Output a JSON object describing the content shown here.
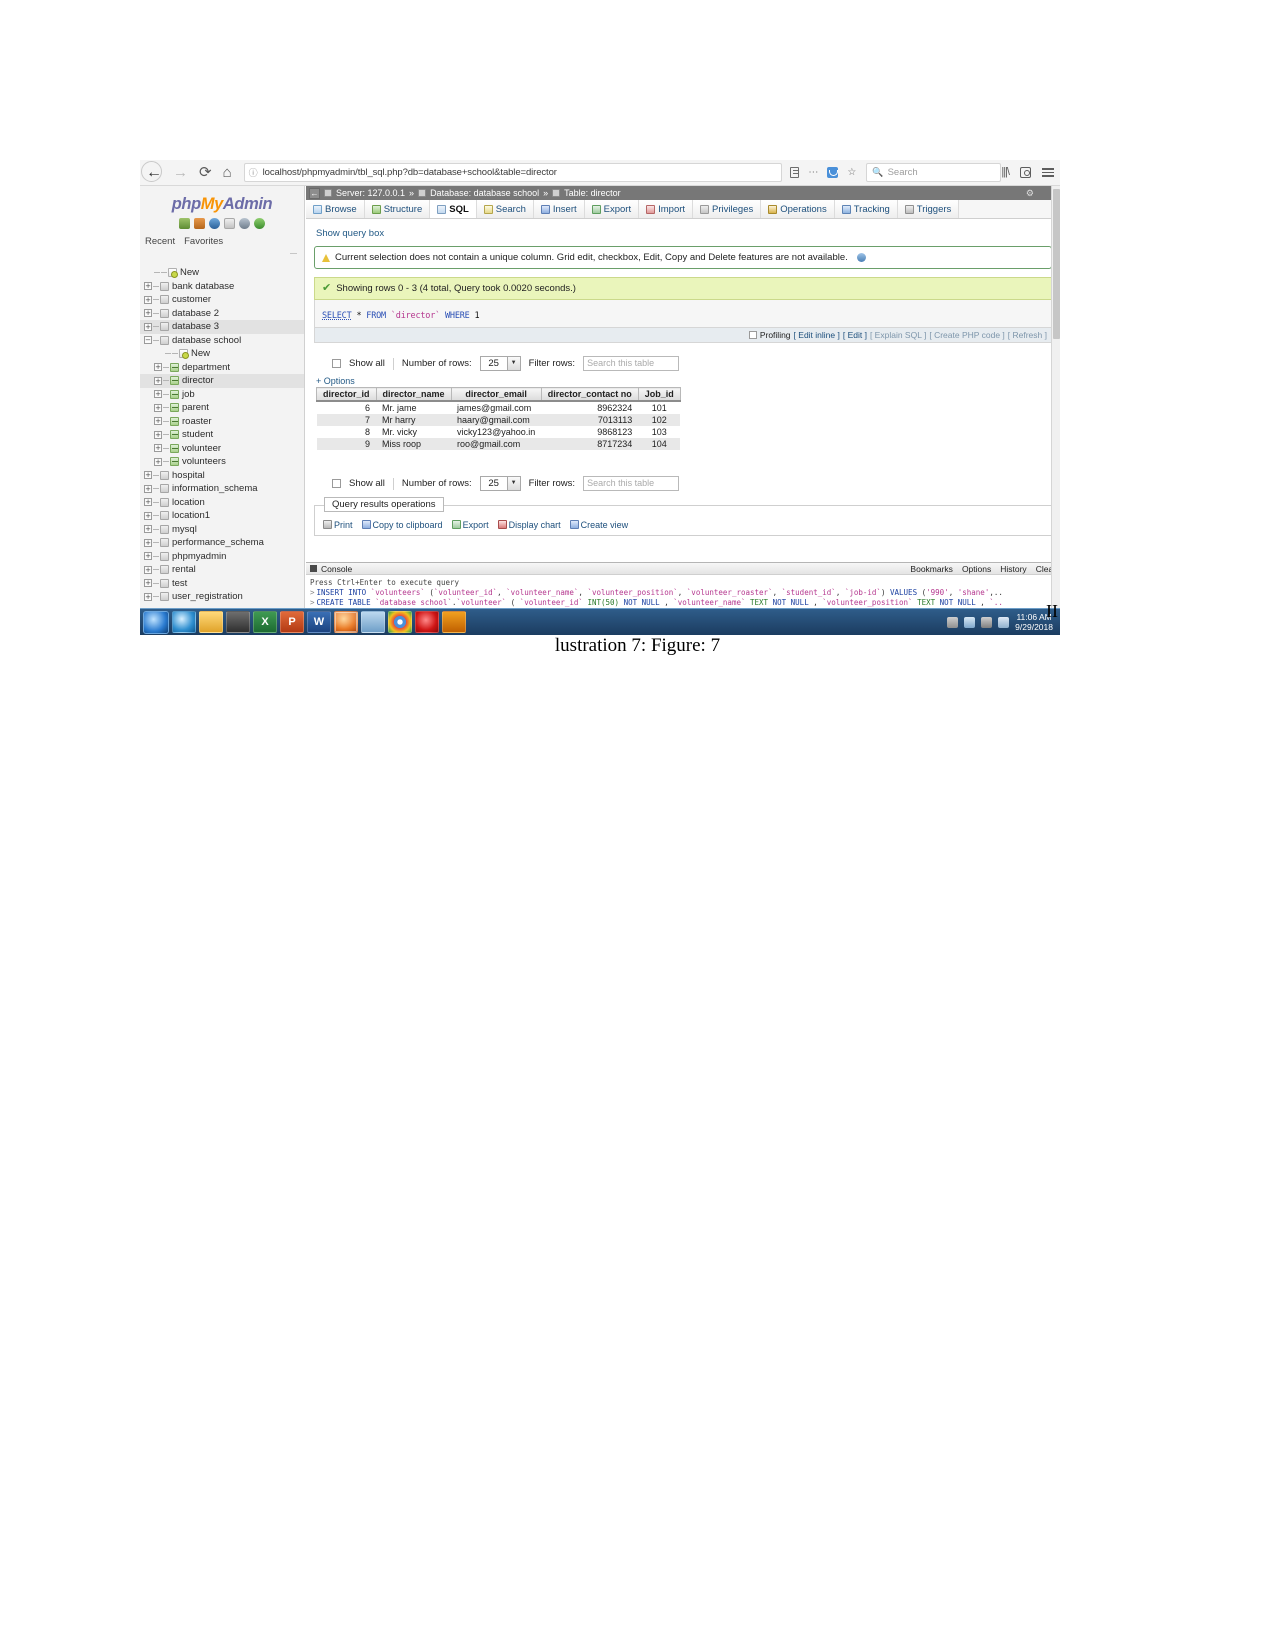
{
  "browser": {
    "nav": {
      "back": "←",
      "forward": "→",
      "reload": "⟳",
      "home": "⌂"
    },
    "url": "localhost/phpmyadmin/tbl_sql.php?db=database+school&table=director",
    "url_info_icon": "ⓘ",
    "search_placeholder": "Search",
    "search_icon": "search-icon",
    "library_icon": "|||\\",
    "reader_icon": "reader-mode-icon",
    "pocket_icon": "pocket-icon",
    "bookmark_icon": "☆",
    "account_icon": "account-icon",
    "menu_icon": "hamburger-icon"
  },
  "sidebar": {
    "logo": {
      "php": "php",
      "my": "My",
      "admin": "Admin"
    },
    "quick_icons": [
      "home-icon",
      "database-icon",
      "sql-icon",
      "docs-icon",
      "settings-icon",
      "reload-icon"
    ],
    "recent": "Recent",
    "favorites": "Favorites",
    "pin_icon": "collapse-icon",
    "tree": [
      {
        "label": "New",
        "level": 1,
        "icon": "new-icon",
        "toggle": "",
        "selected": false
      },
      {
        "label": "bank database",
        "level": 0,
        "icon": "db-icon",
        "toggle": "+",
        "selected": false
      },
      {
        "label": "customer",
        "level": 0,
        "icon": "db-icon",
        "toggle": "+",
        "selected": false
      },
      {
        "label": "database 2",
        "level": 0,
        "icon": "db-icon",
        "toggle": "+",
        "selected": false
      },
      {
        "label": "database 3",
        "level": 0,
        "icon": "db-icon",
        "toggle": "+",
        "selected": true
      },
      {
        "label": "database school",
        "level": 0,
        "icon": "db-icon",
        "toggle": "−",
        "selected": false
      },
      {
        "label": "New",
        "level": 2,
        "icon": "new-icon",
        "toggle": "",
        "selected": false
      },
      {
        "label": "department",
        "level": 1,
        "icon": "table-icon",
        "toggle": "+",
        "selected": false
      },
      {
        "label": "director",
        "level": 1,
        "icon": "table-icon",
        "toggle": "+",
        "selected": true
      },
      {
        "label": "job",
        "level": 1,
        "icon": "table-icon",
        "toggle": "+",
        "selected": false
      },
      {
        "label": "parent",
        "level": 1,
        "icon": "table-icon",
        "toggle": "+",
        "selected": false
      },
      {
        "label": "roaster",
        "level": 1,
        "icon": "table-icon",
        "toggle": "+",
        "selected": false
      },
      {
        "label": "student",
        "level": 1,
        "icon": "table-icon",
        "toggle": "+",
        "selected": false
      },
      {
        "label": "volunteer",
        "level": 1,
        "icon": "table-icon",
        "toggle": "+",
        "selected": false
      },
      {
        "label": "volunteers",
        "level": 1,
        "icon": "table-icon",
        "toggle": "+",
        "selected": false
      },
      {
        "label": "hospital",
        "level": 0,
        "icon": "db-icon",
        "toggle": "+",
        "selected": false
      },
      {
        "label": "information_schema",
        "level": 0,
        "icon": "db-icon",
        "toggle": "+",
        "selected": false
      },
      {
        "label": "location",
        "level": 0,
        "icon": "db-icon",
        "toggle": "+",
        "selected": false
      },
      {
        "label": "location1",
        "level": 0,
        "icon": "db-icon",
        "toggle": "+",
        "selected": false
      },
      {
        "label": "mysql",
        "level": 0,
        "icon": "db-icon",
        "toggle": "+",
        "selected": false
      },
      {
        "label": "performance_schema",
        "level": 0,
        "icon": "db-icon",
        "toggle": "+",
        "selected": false
      },
      {
        "label": "phpmyadmin",
        "level": 0,
        "icon": "db-icon",
        "toggle": "+",
        "selected": false
      },
      {
        "label": "rental",
        "level": 0,
        "icon": "db-icon",
        "toggle": "+",
        "selected": false
      },
      {
        "label": "test",
        "level": 0,
        "icon": "db-icon",
        "toggle": "+",
        "selected": false
      },
      {
        "label": "user_registration",
        "level": 0,
        "icon": "db-icon",
        "toggle": "+",
        "selected": false
      }
    ]
  },
  "breadcrumb": {
    "back_icon": "←",
    "server_label": "Server: 127.0.0.1",
    "sep1": "»",
    "database_label": "Database: database school",
    "sep2": "»",
    "table_label": "Table: director",
    "settings_icon": "gear-icon",
    "collapse_icon": "updown-icon"
  },
  "tabs": [
    {
      "label": "Browse",
      "icon": "browse-icon",
      "active": false
    },
    {
      "label": "Structure",
      "icon": "structure-icon",
      "active": false
    },
    {
      "label": "SQL",
      "icon": "sql-icon",
      "active": true
    },
    {
      "label": "Search",
      "icon": "search-icon",
      "active": false
    },
    {
      "label": "Insert",
      "icon": "insert-icon",
      "active": false
    },
    {
      "label": "Export",
      "icon": "export-icon",
      "active": false
    },
    {
      "label": "Import",
      "icon": "import-icon",
      "active": false
    },
    {
      "label": "Privileges",
      "icon": "privileges-icon",
      "active": false
    },
    {
      "label": "Operations",
      "icon": "operations-icon",
      "active": false
    },
    {
      "label": "Tracking",
      "icon": "tracking-icon",
      "active": false
    },
    {
      "label": "Triggers",
      "icon": "triggers-icon",
      "active": false
    }
  ],
  "main": {
    "show_query_box": "Show query box",
    "warning": "Current selection does not contain a unique column. Grid edit, checkbox, Edit, Copy and Delete features are not available.",
    "warning_icon": "warning-triangle-icon",
    "warning_help_icon": "help-icon",
    "success": "Showing rows 0 - 3 (4 total, Query took 0.0020 seconds.)",
    "success_icon": "check-icon",
    "sql": {
      "select": "SELECT",
      "star": "*",
      "from": "FROM",
      "table": "`director`",
      "where": "WHERE",
      "one": "1"
    },
    "profiling": {
      "label": "Profiling",
      "links": [
        "[ Edit inline ]",
        "[ Edit ]",
        "[ Explain SQL ]",
        "[ Create PHP code ]",
        "[ Refresh ]"
      ]
    },
    "controls_top": {
      "show_all": "Show all",
      "number_of_rows_label": "Number of rows:",
      "number_of_rows_value": "25",
      "dropdown_icon": "chevron-down-icon",
      "filter_rows_label": "Filter rows:",
      "filter_placeholder": "Search this table"
    },
    "options_link": "+ Options",
    "controls_bottom": {
      "show_all": "Show all",
      "number_of_rows_label": "Number of rows:",
      "number_of_rows_value": "25",
      "dropdown_icon": "chevron-down-icon",
      "filter_rows_label": "Filter rows:",
      "filter_placeholder": "Search this table"
    },
    "query_results_operations": {
      "legend": "Query results operations",
      "links": [
        {
          "label": "Print",
          "icon": "print-icon"
        },
        {
          "label": "Copy to clipboard",
          "icon": "copy-icon"
        },
        {
          "label": "Export",
          "icon": "export-icon"
        },
        {
          "label": "Display chart",
          "icon": "chart-icon"
        },
        {
          "label": "Create view",
          "icon": "view-icon"
        }
      ]
    }
  },
  "results_table": {
    "columns": [
      "director_id",
      "director_name",
      "director_email",
      "director_contact no",
      "Job_id"
    ],
    "rows": [
      [
        "6",
        "Mr. jame",
        "james@gmail.com",
        "8962324",
        "101"
      ],
      [
        "7",
        "Mr harry",
        "haary@gmail.com",
        "7013113",
        "102"
      ],
      [
        "8",
        "Mr. vicky",
        "vicky123@yahoo.in",
        "9868123",
        "103"
      ],
      [
        "9",
        "Miss roop",
        "roo@gmail.com",
        "8717234",
        "104"
      ]
    ]
  },
  "console": {
    "title": "Console",
    "icon": "console-icon",
    "right_links": [
      "Bookmarks",
      "Options",
      "History",
      "Clear"
    ],
    "hint": "Press Ctrl+Enter to execute query",
    "lines": [
      "INSERT INTO `volunteers` (`volunteer_id`, `volunteer_name`, `volunteer_position`, `volunteer_roaster`, `student_id`, `job-id`) VALUES ('990', 'shane',..",
      "CREATE TABLE `database school`.`volunteer` ( `volunteer_id` INT(50) NOT NULL , `volunteer_name` TEXT NOT NULL , `volunteer_position` TEXT NOT NULL , `.."
    ]
  },
  "taskbar": {
    "start_icon": "windows-start-icon",
    "buttons": [
      {
        "icon": "firefox-icon",
        "label": ""
      },
      {
        "icon": "ie-icon",
        "label": ""
      },
      {
        "icon": "folder-icon",
        "label": ""
      },
      {
        "icon": "media-icon",
        "label": ""
      },
      {
        "icon": "excel-icon",
        "label": "X"
      },
      {
        "icon": "powerpoint-icon",
        "label": "P"
      },
      {
        "icon": "word-icon",
        "label": "W"
      },
      {
        "icon": "chrome-icon",
        "label": ""
      },
      {
        "icon": "cloud-icon",
        "label": ""
      },
      {
        "icon": "chrome-icon-2",
        "label": ""
      },
      {
        "icon": "opera-icon",
        "label": ""
      },
      {
        "icon": "xampp-icon",
        "label": ""
      }
    ],
    "tray_icons": [
      "show-hidden-icon",
      "shield-icon",
      "network-icon",
      "volume-icon"
    ],
    "time": "11:06 AM",
    "date": "9/29/2018"
  },
  "caption": "lustration 7: Figure: 7",
  "page_mark": "II"
}
